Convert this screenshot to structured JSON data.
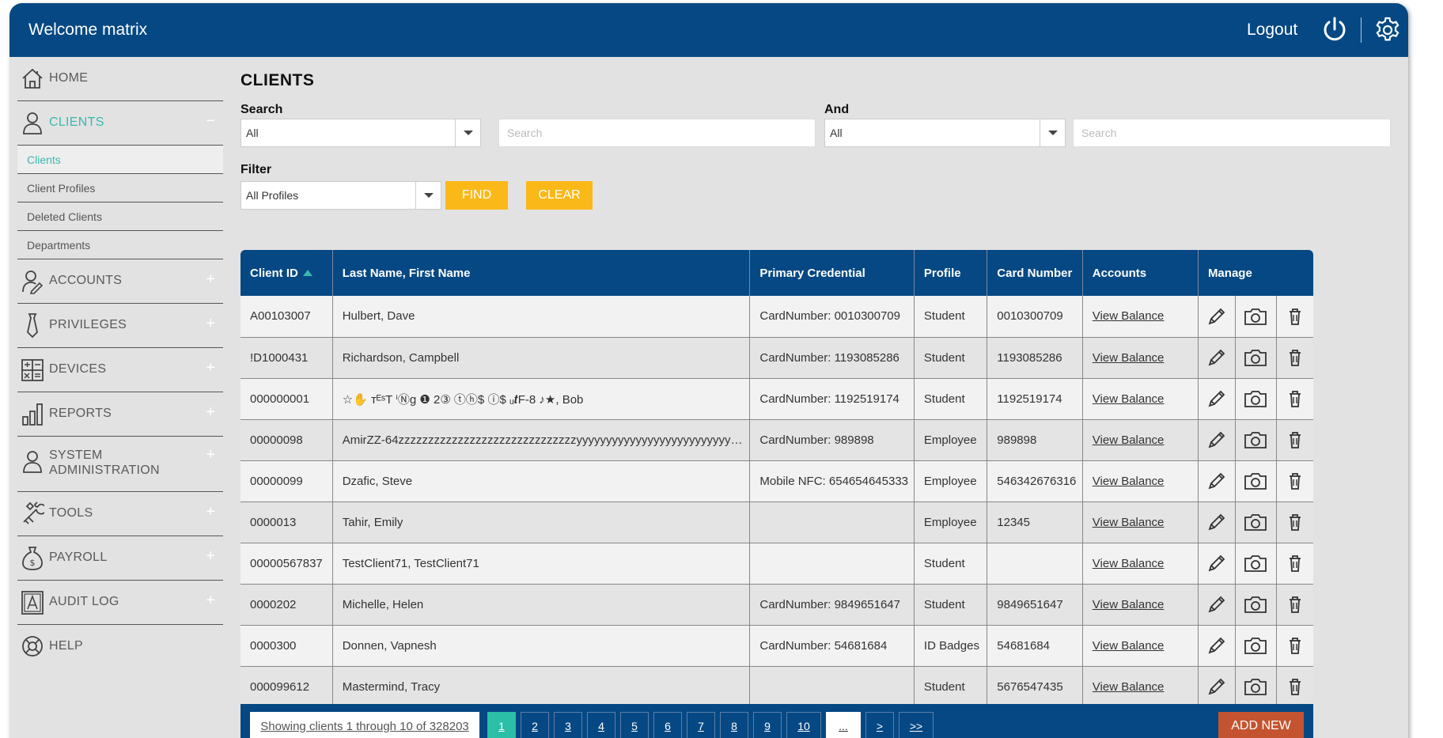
{
  "header": {
    "welcome": "Welcome matrix",
    "logout_label": "Logout",
    "colors": {
      "bar": "#054883",
      "accent": "#3cb8b0",
      "button": "#fbb819",
      "add_new": "#c4542f"
    }
  },
  "sidebar": {
    "items": [
      {
        "label": "HOME",
        "icon": "home-icon",
        "toggle": ""
      },
      {
        "label": "CLIENTS",
        "icon": "user-icon",
        "toggle": "−"
      },
      {
        "label": "ACCOUNTS",
        "icon": "user-edit-icon",
        "toggle": "+"
      },
      {
        "label": "PRIVILEGES",
        "icon": "tie-icon",
        "toggle": "+"
      },
      {
        "label": "DEVICES",
        "icon": "calculator-icon",
        "toggle": "+"
      },
      {
        "label": "REPORTS",
        "icon": "bar-chart-icon",
        "toggle": "+"
      },
      {
        "label": "SYSTEM",
        "label2": "ADMINISTRATION",
        "icon": "admin-user-icon",
        "toggle": "+"
      },
      {
        "label": "TOOLS",
        "icon": "tools-icon",
        "toggle": "+"
      },
      {
        "label": "PAYROLL",
        "icon": "money-bag-icon",
        "toggle": "+"
      },
      {
        "label": "AUDIT LOG",
        "icon": "audit-log-icon",
        "toggle": "+"
      },
      {
        "label": "HELP",
        "icon": "help-icon",
        "toggle": ""
      }
    ],
    "clients_sub": [
      "Clients",
      "Client Profiles",
      "Deleted Clients",
      "Departments"
    ]
  },
  "main": {
    "title": "CLIENTS",
    "search_label": "Search",
    "and_label": "And",
    "search1_select": "All",
    "search1_placeholder": "Search",
    "search2_select": "All",
    "search2_placeholder": "Search",
    "filter_label": "Filter",
    "filter_select": "All Profiles",
    "find_label": "FIND",
    "clear_label": "CLEAR"
  },
  "table": {
    "headers": [
      "Client ID",
      "Last Name, First Name",
      "Primary Credential",
      "Profile",
      "Card Number",
      "Accounts",
      "Manage"
    ],
    "rows": [
      {
        "id": "A00103007",
        "name": "Hulbert, Dave",
        "credential": "CardNumber: 0010300709",
        "profile": "Student",
        "card": "0010300709",
        "accounts": "View Balance"
      },
      {
        "id": "!D1000431",
        "name": "Richardson, Campbell",
        "credential": "CardNumber: 1193085286",
        "profile": "Student",
        "card": "1193085286",
        "accounts": "View Balance"
      },
      {
        "id": "000000001",
        "name": "☆✋ ᴛᴱˢT ⁱⓃg ❶ 2③ ⓣⓗ$ ⓘ$ ᵤ𝒕F-8 ♪★, Bob",
        "credential": "CardNumber: 1192519174",
        "profile": "Student",
        "card": "1192519174",
        "accounts": "View Balance"
      },
      {
        "id": "00000098",
        "name": "AmirZZ-64zzzzzzzzzzzzzzzzzzzzzzzzzzzzzzyyyyyyyyyyyyyyyyyyyyyyyyyyyyyyy...",
        "credential": "CardNumber: 989898",
        "profile": "Employee",
        "card": "989898",
        "accounts": "View Balance"
      },
      {
        "id": "00000099",
        "name": "Dzafic, Steve",
        "credential": "Mobile NFC: 654654645333",
        "profile": "Employee",
        "card": "546342676316",
        "accounts": "View Balance"
      },
      {
        "id": "0000013",
        "name": "Tahir, Emily",
        "credential": "",
        "profile": "Employee",
        "card": "12345",
        "accounts": "View Balance"
      },
      {
        "id": "00000567837",
        "name": "TestClient71, TestClient71",
        "credential": "",
        "profile": "Student",
        "card": "",
        "accounts": "View Balance"
      },
      {
        "id": "0000202",
        "name": "Michelle, Helen",
        "credential": "CardNumber: 9849651647",
        "profile": "Student",
        "card": "9849651647",
        "accounts": "View Balance"
      },
      {
        "id": "0000300",
        "name": "Donnen, Vapnesh",
        "credential": "CardNumber: 54681684",
        "profile": "ID Badges",
        "card": "54681684",
        "accounts": "View Balance"
      },
      {
        "id": "000099612",
        "name": "Mastermind, Tracy",
        "credential": "",
        "profile": "Student",
        "card": "5676547435",
        "accounts": "View Balance"
      }
    ]
  },
  "footer": {
    "showing": "Showing clients 1 through 10 of 328203",
    "pages": [
      "1",
      "2",
      "3",
      "4",
      "5",
      "6",
      "7",
      "8",
      "9",
      "10",
      "...",
      ">",
      ">>"
    ],
    "add_new": "ADD NEW"
  }
}
